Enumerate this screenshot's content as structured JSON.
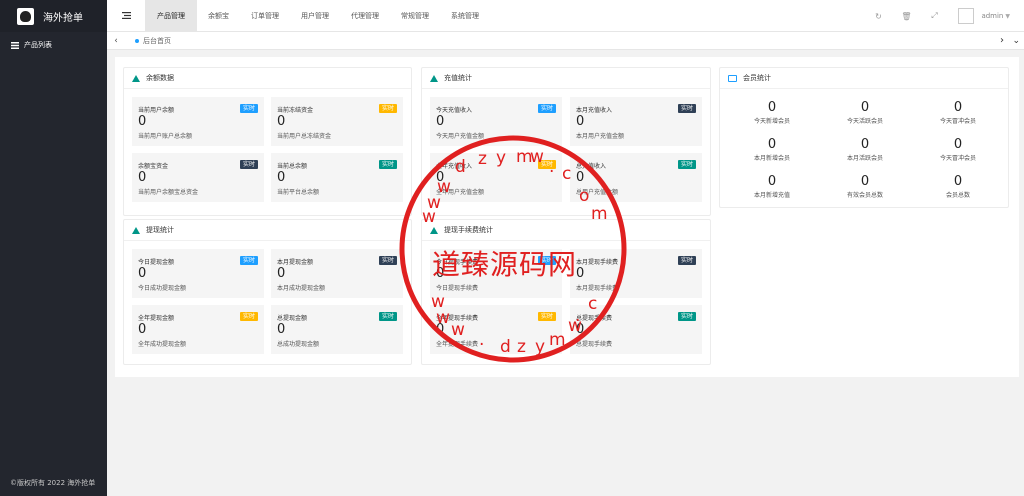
{
  "sidebar": {
    "logo_text": "海外抢单",
    "items": [
      {
        "label": "产品列表"
      }
    ],
    "copyright": "©版权所有 2022 海外抢单"
  },
  "header": {
    "menu_icon": "menu-icon",
    "tabs": [
      {
        "label": "产品管理",
        "active": true
      },
      {
        "label": "余额宝"
      },
      {
        "label": "订单管理"
      },
      {
        "label": "用户管理"
      },
      {
        "label": "代理管理"
      },
      {
        "label": "常规管理"
      },
      {
        "label": "系统管理"
      }
    ],
    "user": "admin"
  },
  "breadcrumb": {
    "tab": "后台首页"
  },
  "panels": {
    "balance": {
      "title": "余额数据",
      "stats": [
        {
          "label": "当前用户余额",
          "badge": "实时",
          "badge_color": "#1e9fff",
          "value": "0",
          "desc": "当前用户账户总余额"
        },
        {
          "label": "当前冻结资金",
          "badge": "实时",
          "badge_color": "#ffb800",
          "value": "0",
          "desc": "当前用户总冻结资金"
        },
        {
          "label": "余额宝资金",
          "badge": "实时",
          "badge_color": "#2f4056",
          "value": "0",
          "desc": "当前用户余额宝总资金"
        },
        {
          "label": "当前总余额",
          "badge": "实时",
          "badge_color": "#009688",
          "value": "0",
          "desc": "当前平台总余额"
        }
      ]
    },
    "recharge": {
      "title": "充值统计",
      "stats": [
        {
          "label": "今天充值收入",
          "badge": "实时",
          "badge_color": "#1e9fff",
          "value": "0",
          "desc": "今天用户充值金额"
        },
        {
          "label": "本月充值收入",
          "badge": "实时",
          "badge_color": "#2f4056",
          "value": "0",
          "desc": "本月用户充值金额"
        },
        {
          "label": "全年充值收入",
          "badge": "实时",
          "badge_color": "#ffb800",
          "value": "0",
          "desc": "全年用户充值金额"
        },
        {
          "label": "总充值收入",
          "badge": "实时",
          "badge_color": "#009688",
          "value": "0",
          "desc": "总用户充值金额"
        }
      ]
    },
    "members": {
      "title": "会员统计",
      "stats": [
        {
          "value": "0",
          "label": "今天新增会员"
        },
        {
          "value": "0",
          "label": "今天活跃会员"
        },
        {
          "value": "0",
          "label": "今天冒冲会员"
        },
        {
          "value": "0",
          "label": "本月新增会员"
        },
        {
          "value": "0",
          "label": "本月活跃会员"
        },
        {
          "value": "0",
          "label": "今天冒冲会员"
        },
        {
          "value": "0",
          "label": "本月新增充值"
        },
        {
          "value": "0",
          "label": "有效会员总数"
        },
        {
          "value": "0",
          "label": "会员总数"
        }
      ]
    },
    "withdraw": {
      "title": "提现统计",
      "stats": [
        {
          "label": "今日提现金额",
          "badge": "实时",
          "badge_color": "#1e9fff",
          "value": "0",
          "desc": "今日成功提现金额"
        },
        {
          "label": "本月提现金额",
          "badge": "实时",
          "badge_color": "#2f4056",
          "value": "0",
          "desc": "本月成功提现金额"
        },
        {
          "label": "全年提现金额",
          "badge": "实时",
          "badge_color": "#ffb800",
          "value": "0",
          "desc": "全年成功提现金额"
        },
        {
          "label": "总提现金额",
          "badge": "实时",
          "badge_color": "#009688",
          "value": "0",
          "desc": "总成功提现金额"
        }
      ]
    },
    "fee": {
      "title": "提现手续费统计",
      "stats": [
        {
          "label": "今日提现手续费",
          "badge": "实时",
          "badge_color": "#1e9fff",
          "value": "0",
          "desc": "今日提现手续费"
        },
        {
          "label": "本月提现手续费",
          "badge": "实时",
          "badge_color": "#2f4056",
          "value": "0",
          "desc": "本月提现手续费"
        },
        {
          "label": "全年提现手续费",
          "badge": "实时",
          "badge_color": "#ffb800",
          "value": "0",
          "desc": "全年提现手续费"
        },
        {
          "label": "总提现手续费",
          "badge": "实时",
          "badge_color": "#009688",
          "value": "0",
          "desc": "总提现手续费"
        }
      ]
    }
  },
  "watermark": {
    "text": "道臻源码网",
    "url_chars": [
      "w",
      "w",
      "w",
      ".",
      "d",
      "z",
      "y",
      "m",
      "w",
      ".",
      "c",
      "o",
      "m"
    ]
  }
}
